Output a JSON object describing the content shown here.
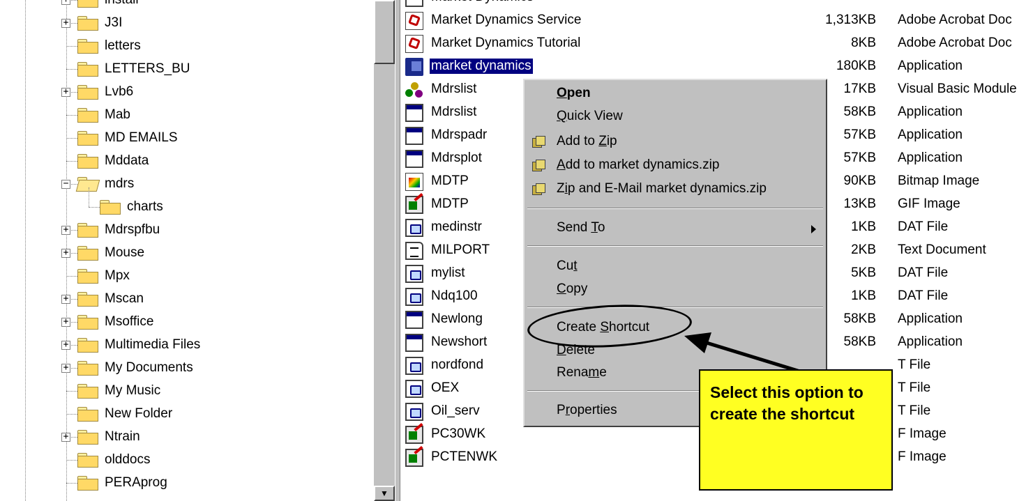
{
  "tree": {
    "items": [
      {
        "label": "install",
        "expander": "+"
      },
      {
        "label": "J3I",
        "expander": "+"
      },
      {
        "label": "letters",
        "expander": ""
      },
      {
        "label": "LETTERS_BU",
        "expander": ""
      },
      {
        "label": "Lvb6",
        "expander": "+"
      },
      {
        "label": "Mab",
        "expander": ""
      },
      {
        "label": "MD EMAILS",
        "expander": ""
      },
      {
        "label": "Mddata",
        "expander": ""
      },
      {
        "label": "mdrs",
        "expander": "−"
      },
      {
        "label": "charts",
        "expander": ""
      },
      {
        "label": "Mdrspfbu",
        "expander": "+"
      },
      {
        "label": "Mouse",
        "expander": "+"
      },
      {
        "label": "Mpx",
        "expander": ""
      },
      {
        "label": "Mscan",
        "expander": "+"
      },
      {
        "label": "Msoffice",
        "expander": "+"
      },
      {
        "label": "Multimedia Files",
        "expander": "+"
      },
      {
        "label": "My Documents",
        "expander": "+"
      },
      {
        "label": "My Music",
        "expander": ""
      },
      {
        "label": "New Folder",
        "expander": ""
      },
      {
        "label": "Ntrain",
        "expander": "+"
      },
      {
        "label": "olddocs",
        "expander": ""
      },
      {
        "label": "PERAprog",
        "expander": ""
      }
    ]
  },
  "files": [
    {
      "name": "Market Dynamics",
      "size": "",
      "type": "",
      "icon": "app-icon"
    },
    {
      "name": "Market Dynamics Service",
      "size": "1,313KB",
      "type": "Adobe Acrobat Doc",
      "icon": "pdf-icon"
    },
    {
      "name": "Market Dynamics Tutorial",
      "size": "8KB",
      "type": "Adobe Acrobat Doc",
      "icon": "pdf-icon"
    },
    {
      "name": "market dynamics",
      "size": "180KB",
      "type": "Application",
      "icon": "exe-icon"
    },
    {
      "name": "Mdrslist",
      "size": "17KB",
      "type": "Visual Basic Module",
      "icon": "vb-module-icon"
    },
    {
      "name": "Mdrslist",
      "size": "58KB",
      "type": "Application",
      "icon": "app-icon"
    },
    {
      "name": "Mdrspadr",
      "size": "57KB",
      "type": "Application",
      "icon": "app-icon"
    },
    {
      "name": "Mdrsplot",
      "size": "57KB",
      "type": "Application",
      "icon": "app-icon"
    },
    {
      "name": "MDTP",
      "size": "90KB",
      "type": "Bitmap Image",
      "icon": "bitmap-icon"
    },
    {
      "name": "MDTP",
      "size": "13KB",
      "type": "GIF Image",
      "icon": "gif-icon"
    },
    {
      "name": "medinstr",
      "size": "1KB",
      "type": "DAT File",
      "icon": "dat-icon"
    },
    {
      "name": "MILPORT",
      "size": "2KB",
      "type": "Text Document",
      "icon": "text-icon"
    },
    {
      "name": "mylist",
      "size": "5KB",
      "type": "DAT File",
      "icon": "dat-icon"
    },
    {
      "name": "Ndq100",
      "size": "1KB",
      "type": "DAT File",
      "icon": "dat-icon"
    },
    {
      "name": "Newlong",
      "size": "58KB",
      "type": "Application",
      "icon": "app-icon"
    },
    {
      "name": "Newshort",
      "size": "58KB",
      "type": "Application",
      "icon": "app-icon"
    },
    {
      "name": "nordfond",
      "size": "",
      "type": "T File",
      "icon": "dat-icon"
    },
    {
      "name": "OEX",
      "size": "",
      "type": "T File",
      "icon": "dat-icon"
    },
    {
      "name": "Oil_serv",
      "size": "",
      "type": "T File",
      "icon": "dat-icon"
    },
    {
      "name": "PC30WK",
      "size": "",
      "type": "F Image",
      "icon": "gif-icon"
    },
    {
      "name": "PCTENWK",
      "size": "",
      "type": "F Image",
      "icon": "gif-icon"
    }
  ],
  "selected_file_index": 3,
  "context_menu": {
    "items": [
      {
        "label": "Open",
        "bold": true,
        "icon": ""
      },
      {
        "label": "Quick View",
        "bold": false,
        "icon": ""
      },
      {
        "label": "Add to Zip",
        "bold": false,
        "icon": "winzip-icon"
      },
      {
        "label": "Add to market dynamics.zip",
        "bold": false,
        "icon": "winzip-icon"
      },
      {
        "label": "Zip and E-Mail market dynamics.zip",
        "bold": false,
        "icon": "winzip-icon"
      },
      {
        "label": "Send To",
        "bold": false,
        "icon": "",
        "submenu": true
      },
      {
        "label": "Cut",
        "bold": false,
        "icon": ""
      },
      {
        "label": "Copy",
        "bold": false,
        "icon": ""
      },
      {
        "label": "Create Shortcut",
        "bold": false,
        "icon": ""
      },
      {
        "label": "Delete",
        "bold": false,
        "icon": ""
      },
      {
        "label": "Rename",
        "bold": false,
        "icon": ""
      },
      {
        "label": "Properties",
        "bold": false,
        "icon": ""
      }
    ]
  },
  "annotation": {
    "text": "Select this option to create the shortcut",
    "background": "#ffff22"
  },
  "colors": {
    "selection": "#000080",
    "menu_face": "#c0c0c0",
    "folder": "#ffd966"
  }
}
